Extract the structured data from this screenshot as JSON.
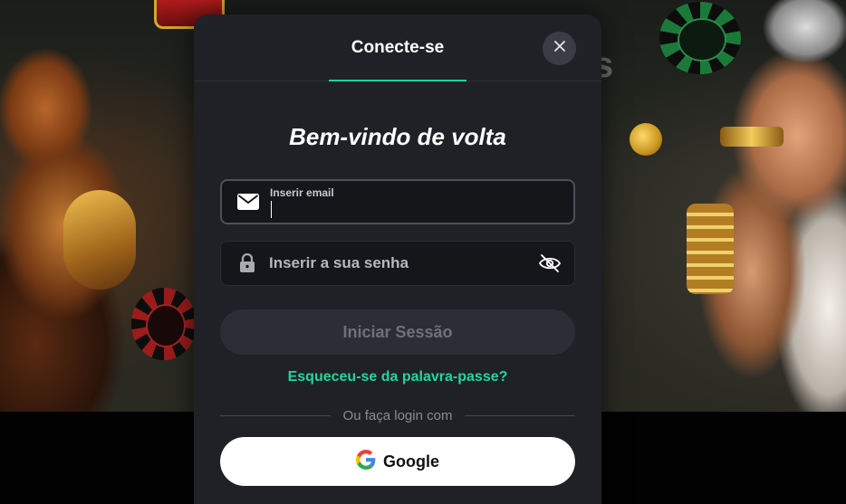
{
  "modal": {
    "tab_label": "Conecte-se",
    "close_icon": "close-icon",
    "title": "Bem-vindo de volta",
    "email_field": {
      "label": "Inserir email",
      "value": "",
      "icon": "envelope-icon"
    },
    "password_field": {
      "placeholder": "Inserir a sua senha",
      "value": "",
      "icon": "lock-icon",
      "toggle_icon": "eye-off-icon"
    },
    "login_button": "Iniciar Sessão",
    "forgot_link": "Esqueceu-se da palavra-passe?",
    "divider_text": "Ou faça login com",
    "google_button": {
      "label": "Google",
      "icon": "google-icon"
    }
  },
  "colors": {
    "accent": "#20d39a",
    "modal_bg": "#1f2126",
    "input_bg": "#15161a",
    "disabled_button": "#2b2e34"
  }
}
